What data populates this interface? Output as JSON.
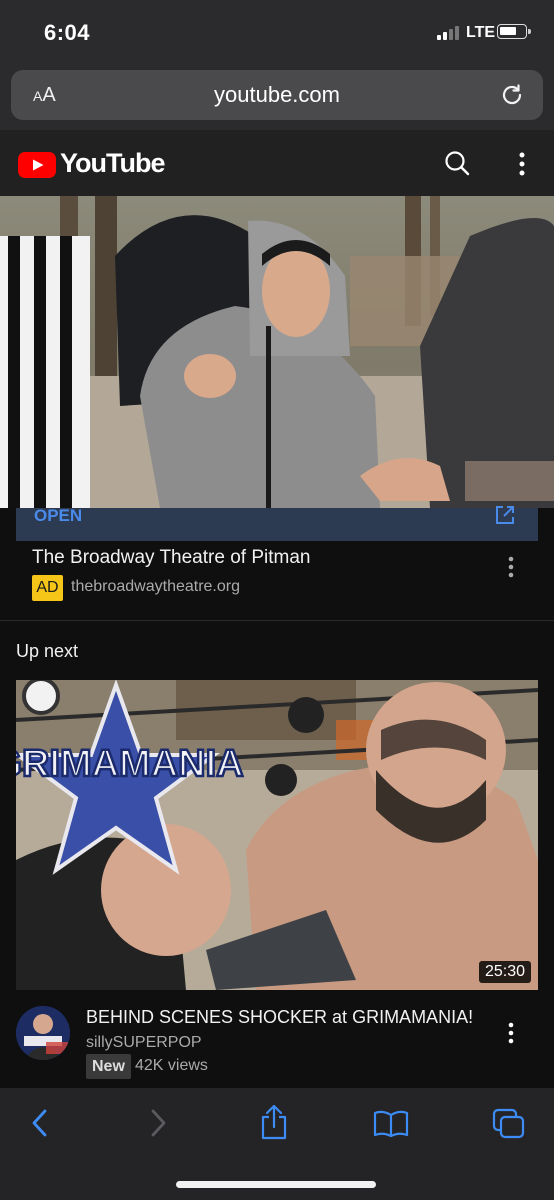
{
  "status_bar": {
    "time": "6:04",
    "network": "LTE"
  },
  "address_bar": {
    "aa_label_small": "A",
    "aa_label_large": "A",
    "url": "youtube.com"
  },
  "youtube_header": {
    "logo_text": "YouTube"
  },
  "ad": {
    "cta_label": "OPEN",
    "title": "The Broadway Theatre of Pitman",
    "badge": "AD",
    "url": "thebroadwaytheatre.org"
  },
  "up_next": {
    "heading": "Up next",
    "video": {
      "thumbnail_text": "GRIMAMANIA",
      "duration": "25:30",
      "title": "BEHIND SCENES SHOCKER at GRIMAMANIA!",
      "channel": "sillySUPERPOP",
      "badge": "New",
      "views": "42K views"
    }
  },
  "colors": {
    "youtube_red": "#ff0000",
    "ad_badge": "#f5c518",
    "open_link": "#4a8ae8",
    "toolbar_icons": "#3d8cf5"
  },
  "icons": [
    "signal-icon",
    "battery-icon",
    "reload-icon",
    "search-icon",
    "more-vert-icon",
    "external-link-icon",
    "back-icon",
    "forward-icon",
    "share-icon",
    "bookmarks-icon",
    "tabs-icon"
  ]
}
